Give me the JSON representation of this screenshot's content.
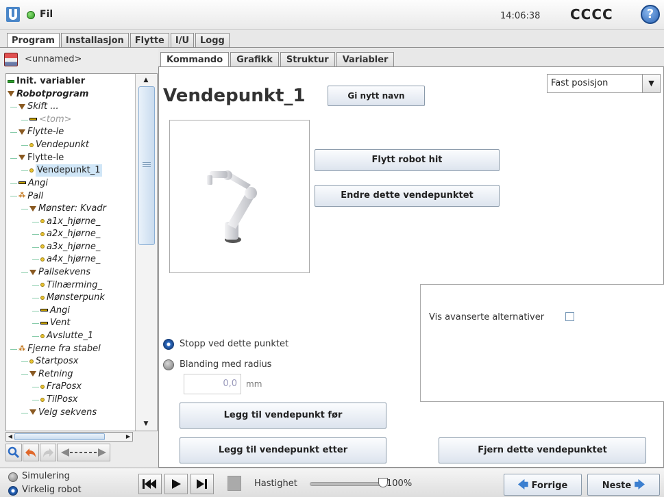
{
  "header": {
    "file_menu": "Fil",
    "time": "14:06:38",
    "robot_name": "CCCC",
    "help": "?"
  },
  "main_tabs": [
    "Program",
    "Installasjon",
    "Flytte",
    "I/U",
    "Logg"
  ],
  "active_main_tab": "Program",
  "program": {
    "name": "<unnamed>"
  },
  "tree": [
    {
      "label": "Init. variabler",
      "indent": 0,
      "icon": "variable-icon",
      "style": "bold"
    },
    {
      "label": "Robotprogram",
      "indent": 0,
      "icon": "expand-triangle-icon",
      "style": "bold-italic"
    },
    {
      "label": "Skift ...",
      "indent": 1,
      "icon": "expand-triangle-icon",
      "style": "italic"
    },
    {
      "label": "<tom>",
      "indent": 2,
      "icon": "set-icon",
      "style": "italic-gray"
    },
    {
      "label": "Flytte-le",
      "indent": 1,
      "icon": "expand-triangle-icon",
      "style": "italic"
    },
    {
      "label": "Vendepunkt",
      "indent": 2,
      "icon": "waypoint-icon",
      "style": "italic"
    },
    {
      "label": "Flytte-le",
      "indent": 1,
      "icon": "expand-triangle-icon",
      "style": "normal"
    },
    {
      "label": "Vendepunkt_1",
      "indent": 2,
      "icon": "waypoint-icon",
      "style": "selected"
    },
    {
      "label": "Angi",
      "indent": 1,
      "icon": "set-icon",
      "style": "italic"
    },
    {
      "label": "Pall",
      "indent": 1,
      "icon": "pallet-icon",
      "style": "italic"
    },
    {
      "label": "Mønster: Kvadr",
      "indent": 2,
      "icon": "expand-triangle-icon",
      "style": "italic"
    },
    {
      "label": "a1x_hjørne_",
      "indent": 3,
      "icon": "waypoint-icon",
      "style": "italic"
    },
    {
      "label": "a2x_hjørne_",
      "indent": 3,
      "icon": "waypoint-icon",
      "style": "italic"
    },
    {
      "label": "a3x_hjørne_",
      "indent": 3,
      "icon": "waypoint-icon",
      "style": "italic"
    },
    {
      "label": "a4x_hjørne_",
      "indent": 3,
      "icon": "waypoint-icon",
      "style": "italic"
    },
    {
      "label": "Pallsekvens",
      "indent": 2,
      "icon": "expand-triangle-icon",
      "style": "italic"
    },
    {
      "label": "Tilnærming_",
      "indent": 3,
      "icon": "waypoint-icon",
      "style": "italic"
    },
    {
      "label": "Mønsterpunk",
      "indent": 3,
      "icon": "waypoint-icon",
      "style": "italic"
    },
    {
      "label": "Angi",
      "indent": 3,
      "icon": "set-icon",
      "style": "italic"
    },
    {
      "label": "Vent",
      "indent": 3,
      "icon": "set-icon",
      "style": "italic"
    },
    {
      "label": "Avslutte_1",
      "indent": 3,
      "icon": "waypoint-icon",
      "style": "italic"
    },
    {
      "label": "Fjerne fra stabel",
      "indent": 1,
      "icon": "pallet-icon",
      "style": "italic"
    },
    {
      "label": "Startposx",
      "indent": 2,
      "icon": "waypoint-icon",
      "style": "italic"
    },
    {
      "label": "Retning",
      "indent": 2,
      "icon": "expand-triangle-icon",
      "style": "italic"
    },
    {
      "label": "FraPosx",
      "indent": 3,
      "icon": "waypoint-icon",
      "style": "italic"
    },
    {
      "label": "TilPosx",
      "indent": 3,
      "icon": "waypoint-icon",
      "style": "italic"
    },
    {
      "label": "Velg sekvens",
      "indent": 2,
      "icon": "expand-triangle-icon",
      "style": "italic"
    }
  ],
  "sub_tabs": [
    "Kommando",
    "Grafikk",
    "Struktur",
    "Variabler"
  ],
  "active_sub_tab": "Kommando",
  "waypoint": {
    "title": "Vendepunkt_1",
    "rename_button": "Gi nytt navn",
    "position_type": "Fast posisjon",
    "move_here_button": "Flytt robot hit",
    "edit_button": "Endre dette vendepunktet",
    "show_advanced_label": "Vis avanserte alternativer",
    "stop_option": "Stopp ved dette punktet",
    "blend_option": "Blanding med radius",
    "blend_radius_value": "0,0",
    "blend_radius_unit": "mm",
    "add_before_button": "Legg til vendepunkt før",
    "add_after_button": "Legg til vendepunkt etter",
    "delete_button": "Fjern dette vendepunktet"
  },
  "footer": {
    "simulation_label": "Simulering",
    "real_robot_label": "Virkelig robot",
    "speed_label": "Hastighet",
    "speed_value": "100%",
    "speed_fraction": 1.0,
    "prev_button": "Forrige",
    "next_button": "Neste"
  }
}
